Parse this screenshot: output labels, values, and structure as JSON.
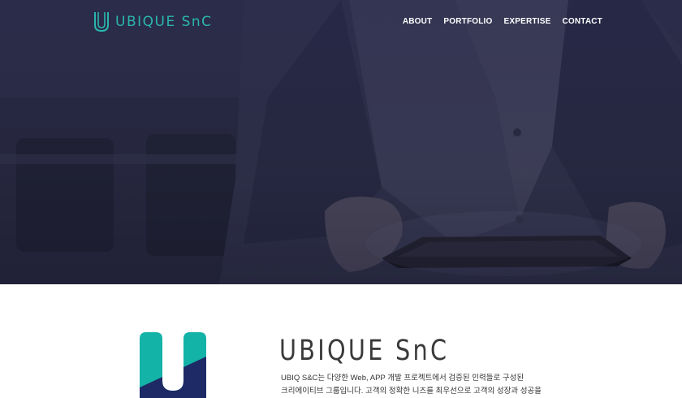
{
  "header": {
    "logo_text": "UBIQUE SnC",
    "nav": [
      {
        "label": "ABOUT"
      },
      {
        "label": "PORTFOLIO"
      },
      {
        "label": "EXPERTISE"
      },
      {
        "label": "CONTACT"
      }
    ]
  },
  "about": {
    "title": "UBIQUE SnC",
    "description_lines": [
      "UBIQ S&C는 다양한 Web, APP 개발 프로젝트에서 검증된 인력들로 구성된",
      "크리에이티브 그룹입니다. 고객의 정확한 니즈를 최우선으로 고객의 성장과 성공을"
    ]
  },
  "colors": {
    "brand_teal": "#14b3a7",
    "brand_navy": "#1e2a66",
    "hero_overlay": "#2b2d45"
  }
}
